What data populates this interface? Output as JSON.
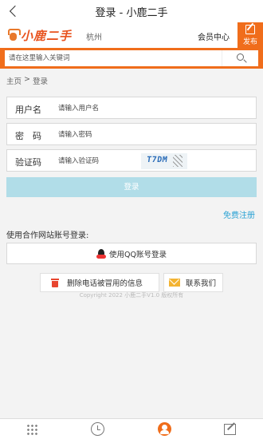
{
  "nav": {
    "title": "登录 - 小鹿二手"
  },
  "header": {
    "logo_text": "小鹿二手",
    "city": "杭州",
    "member_center": "会员中心",
    "publish_label": "发布"
  },
  "search": {
    "placeholder": "请在这里输入关键词"
  },
  "breadcrumb": {
    "home": "主页",
    "separator": ">",
    "current": "登录"
  },
  "form": {
    "username": {
      "label": "用户名",
      "placeholder": "请输入用户名"
    },
    "password": {
      "label": "密　码",
      "placeholder": "请输入密码"
    },
    "captcha": {
      "label": "验证码",
      "placeholder": "请输入验证码",
      "image_text": "T7DM"
    },
    "login_label": "登录",
    "register_label": "免费注册"
  },
  "partner": {
    "title": "使用合作网站账号登录:",
    "qq_label": "使用QQ账号登录"
  },
  "actions": {
    "delete_label": "删除电话被冒用的信息",
    "contact_label": "联系我们"
  },
  "footer": {
    "copyright": "Copyright 2022 小鹿二手V1.0 版权所有"
  },
  "tabbar": {
    "items": [
      {
        "icon": "grid-icon"
      },
      {
        "icon": "clock-icon"
      },
      {
        "icon": "user-icon",
        "active": true
      },
      {
        "icon": "edit-icon"
      }
    ]
  },
  "colors": {
    "brand_orange": "#f06d1b",
    "login_button": "#b1dde8",
    "link_blue": "#2aa2d4"
  }
}
